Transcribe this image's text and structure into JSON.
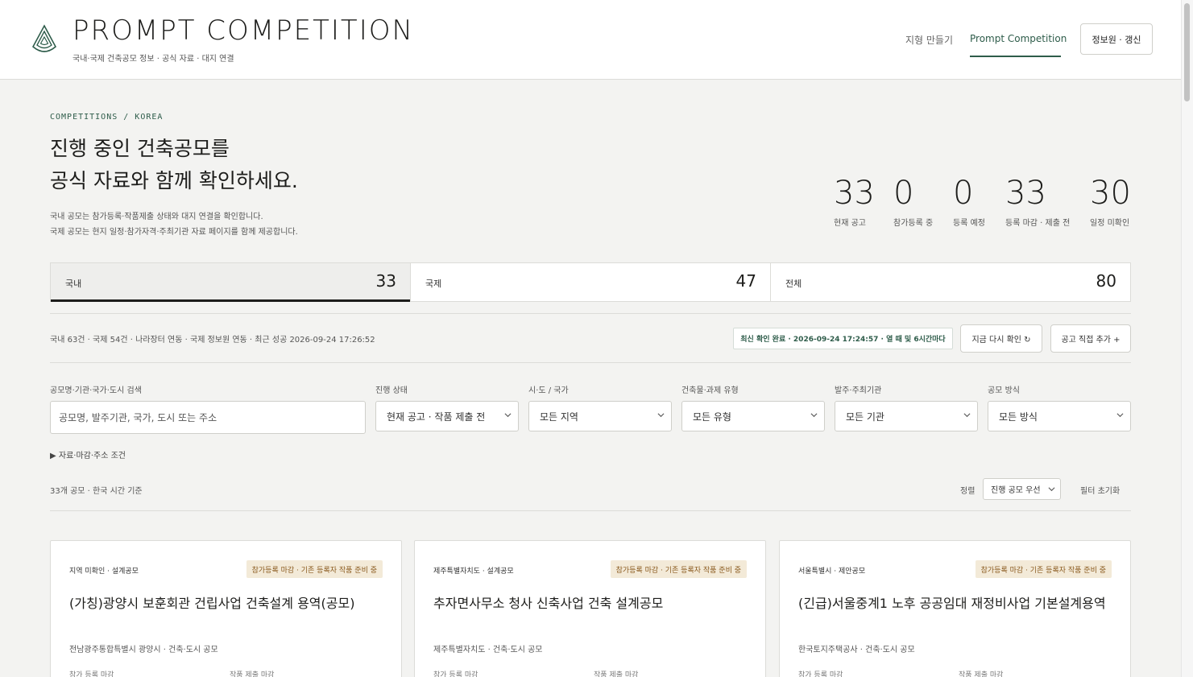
{
  "header": {
    "brand": "PROMPT COMPETITION",
    "subtitle": "국내·국제 건축공모 정보 · 공식 자료 · 대지 연결",
    "nav": [
      {
        "label": "지형 만들기",
        "active": false
      },
      {
        "label": "Prompt Competition",
        "active": true
      }
    ],
    "info_button": "정보원 · 갱신",
    "accent_color": "#2e5c4a"
  },
  "hero": {
    "kicker": "COMPETITIONS / KOREA",
    "title_line1": "진행 중인 건축공모를",
    "title_line2": "공식 자료와 함께 확인하세요.",
    "desc_line1": "국내 공모는 참가등록·작품제출 상태와 대지 연결을 확인합니다.",
    "desc_line2": "국제 공모는 현지 일정·참가자격·주최기관 자료 페이지를 함께 제공합니다."
  },
  "stats": [
    {
      "value": "33",
      "label": "현재 공고"
    },
    {
      "value": "0",
      "label": "참가등록 중"
    },
    {
      "value": "0",
      "label": "등록 예정"
    },
    {
      "value": "33",
      "label": "등록 마감 · 제출 전"
    },
    {
      "value": "30",
      "label": "일정 미확인"
    }
  ],
  "tabs": [
    {
      "label": "국내",
      "count": "33",
      "active": true
    },
    {
      "label": "국제",
      "count": "47",
      "active": false
    },
    {
      "label": "전체",
      "count": "80",
      "active": false
    }
  ],
  "sync": {
    "info": "국내 63건 · 국제 54건 · 나라장터 연동 · 국제 정보원 연동 · 최근 성공 2026-09-24 17:26:52",
    "badge": "최신 확인 완료 · 2026-09-24 17:24:57 · 열 때 및 6시간마다",
    "recheck_button": "지금 다시 확인 ↻",
    "add_button": "공고 직접 추가 +"
  },
  "filters": {
    "search_label": "공모명·기관·국가·도시 검색",
    "search_placeholder": "공모명, 발주기관, 국가, 도시 또는 주소",
    "status_label": "진행 상태",
    "status_value": "현재 공고 · 작품 제출 전",
    "region_label": "시·도 / 국가",
    "region_value": "모든 지역",
    "type_label": "건축물·과제 유형",
    "type_value": "모든 유형",
    "org_label": "발주·주최기관",
    "org_value": "모든 기관",
    "method_label": "공모 방식",
    "method_value": "모든 방식",
    "details_toggle": "▶ 자료·마감·주소 조건"
  },
  "results": {
    "count_text": "33개 공모 · 한국 시간 기준",
    "sort_label": "정렬",
    "sort_value": "진행 공모 우선",
    "reset": "필터 초기화"
  },
  "cards": [
    {
      "region": "지역 미확인 · 설계공모",
      "badge": "참가등록 마감 · 기존 등록자 작품 준비 중",
      "title": "(가칭)광양시 보훈회관 건립사업 건축설계 용역(공모)",
      "meta": "전남광주통합특별시 광양시 · 건축·도시 공모",
      "col1": "참가 등록 마감",
      "col2": "작품 제출 마감"
    },
    {
      "region": "제주특별자치도 · 설계공모",
      "badge": "참가등록 마감 · 기존 등록자 작품 준비 중",
      "title": "추자면사무소 청사 신축사업 건축 설계공모",
      "meta": "제주특별자치도 · 건축·도시 공모",
      "col1": "참가 등록 마감",
      "col2": "작품 제출 마감"
    },
    {
      "region": "서울특별시 · 제안공모",
      "badge": "참가등록 마감 · 기존 등록자 작품 준비 중",
      "title": "(긴급)서울중계1 노후 공공임대 재정비사업 기본설계용역",
      "meta": "한국토지주택공사 · 건축·도시 공모",
      "col1": "참가 등록 마감",
      "col2": "작품 제출 마감"
    }
  ]
}
